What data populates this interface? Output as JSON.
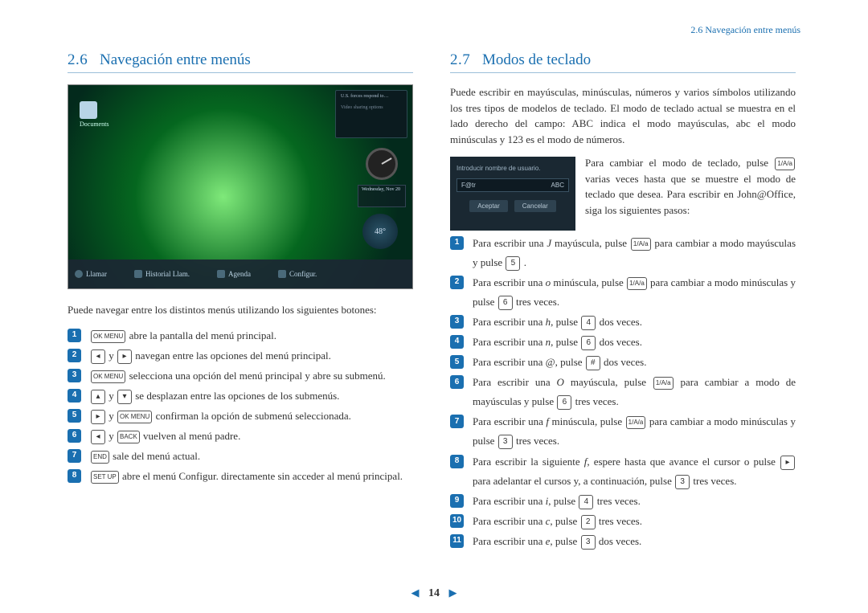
{
  "running_head": "2.6 Navegación entre menús",
  "left": {
    "heading_num": "2.6",
    "heading_text": "Navegación entre menús",
    "screenshot": {
      "docs_label": "Documents",
      "date_text": "Wednesday, Nov 20",
      "temp": "48°",
      "buttons": [
        "Llamar",
        "Historial Llam.",
        "Agenda",
        "Configur."
      ]
    },
    "intro": "Puede navegar entre los distintos menús utilizando los siguientes botones:",
    "items": [
      {
        "n": "1",
        "parts": [
          "",
          {
            "k": "OK\nMENU"
          },
          " abre la pantalla del menú principal."
        ]
      },
      {
        "n": "2",
        "parts": [
          "",
          {
            "k": "◂"
          },
          " y ",
          {
            "k": "▸"
          },
          " navegan entre las opciones del menú principal."
        ]
      },
      {
        "n": "3",
        "parts": [
          "",
          {
            "k": "OK\nMENU"
          },
          " selecciona una opción del menú principal y abre su submenú."
        ]
      },
      {
        "n": "4",
        "parts": [
          "",
          {
            "k": "▴"
          },
          " y ",
          {
            "k": "▾"
          },
          " se desplazan entre las opciones de los submenús."
        ]
      },
      {
        "n": "5",
        "parts": [
          "",
          {
            "k": "▸"
          },
          " y ",
          {
            "k": "OK\nMENU"
          },
          " confirman la opción de submenú seleccionada."
        ]
      },
      {
        "n": "6",
        "parts": [
          "",
          {
            "k": "◂"
          },
          " y ",
          {
            "k": "BACK"
          },
          " vuelven al menú padre."
        ]
      },
      {
        "n": "7",
        "parts": [
          "",
          {
            "k": "END"
          },
          " sale del menú actual."
        ]
      },
      {
        "n": "8",
        "parts": [
          "",
          {
            "k": "SET UP"
          },
          " abre el menú Configur. directamente sin acceder al menú principal."
        ]
      }
    ]
  },
  "right": {
    "heading_num": "2.7",
    "heading_text": "Modos de teclado",
    "para1": "Puede escribir en mayúsculas, minúsculas, números y varios símbolos utilizando los tres tipos de modelos de teclado. El modo de teclado actual se muestra en el lado derecho del campo: ABC indica el modo mayúsculas, abc el modo minúsculas y 123 es el modo de números.",
    "inset": {
      "title": "Introducir nombre de usuario.",
      "field_value": "F@tr",
      "field_mode": "ABC",
      "accept": "Aceptar",
      "cancel": "Cancelar"
    },
    "para2_pre": "Para cambiar el modo de teclado, pulse ",
    "para2_post": " varias veces hasta que se muestre el modo de teclado que desea. Para escribir en John@Office, siga los siguientes pasos:",
    "items": [
      {
        "n": "1",
        "parts": [
          "Para escribir una ",
          {
            "i": "J"
          },
          " mayúscula, pulse ",
          {
            "k": "1/A/a"
          },
          " para cambiar a modo mayúsculas y pulse ",
          {
            "k": "5"
          },
          " ."
        ]
      },
      {
        "n": "2",
        "parts": [
          "Para escribir una ",
          {
            "i": "o"
          },
          " minúscula, pulse ",
          {
            "k": "1/A/a"
          },
          " para cambiar a modo minúsculas y pulse ",
          {
            "k": "6"
          },
          " tres veces."
        ]
      },
      {
        "n": "3",
        "parts": [
          "Para escribir una ",
          {
            "i": "h"
          },
          ", pulse ",
          {
            "k": "4"
          },
          " dos veces."
        ]
      },
      {
        "n": "4",
        "parts": [
          "Para escribir una ",
          {
            "i": "n"
          },
          ", pulse ",
          {
            "k": "6"
          },
          " dos veces."
        ]
      },
      {
        "n": "5",
        "parts": [
          "Para escribir una ",
          {
            "i": "@"
          },
          ", pulse ",
          {
            "k": "#"
          },
          " dos veces."
        ]
      },
      {
        "n": "6",
        "parts": [
          "Para escribir una ",
          {
            "i": "O"
          },
          " mayúscula, pulse ",
          {
            "k": "1/A/a"
          },
          " para cambiar a modo de mayúsculas y pulse ",
          {
            "k": "6"
          },
          " tres veces."
        ]
      },
      {
        "n": "7",
        "parts": [
          "Para escribir una ",
          {
            "i": "f"
          },
          " minúscula, pulse ",
          {
            "k": "1/A/a"
          },
          " para cambiar a modo minúsculas y pulse ",
          {
            "k": "3"
          },
          " tres veces."
        ]
      },
      {
        "n": "8",
        "parts": [
          "Para escribir la siguiente ",
          {
            "i": "f"
          },
          ", espere hasta que avance el cursor o pulse ",
          {
            "k": "▸"
          },
          " para adelantar el cursos y, a continuación, pulse ",
          {
            "k": "3"
          },
          " tres veces."
        ]
      },
      {
        "n": "9",
        "parts": [
          "Para escribir una ",
          {
            "i": "i"
          },
          ", pulse ",
          {
            "k": "4"
          },
          " tres veces."
        ]
      },
      {
        "n": "10",
        "parts": [
          "Para escribir una ",
          {
            "i": "c"
          },
          ", pulse ",
          {
            "k": "2"
          },
          " tres veces."
        ]
      },
      {
        "n": "11",
        "parts": [
          "Para escribir una ",
          {
            "i": "e"
          },
          ", pulse ",
          {
            "k": "3"
          },
          " dos veces."
        ]
      }
    ]
  },
  "page_number": "14"
}
